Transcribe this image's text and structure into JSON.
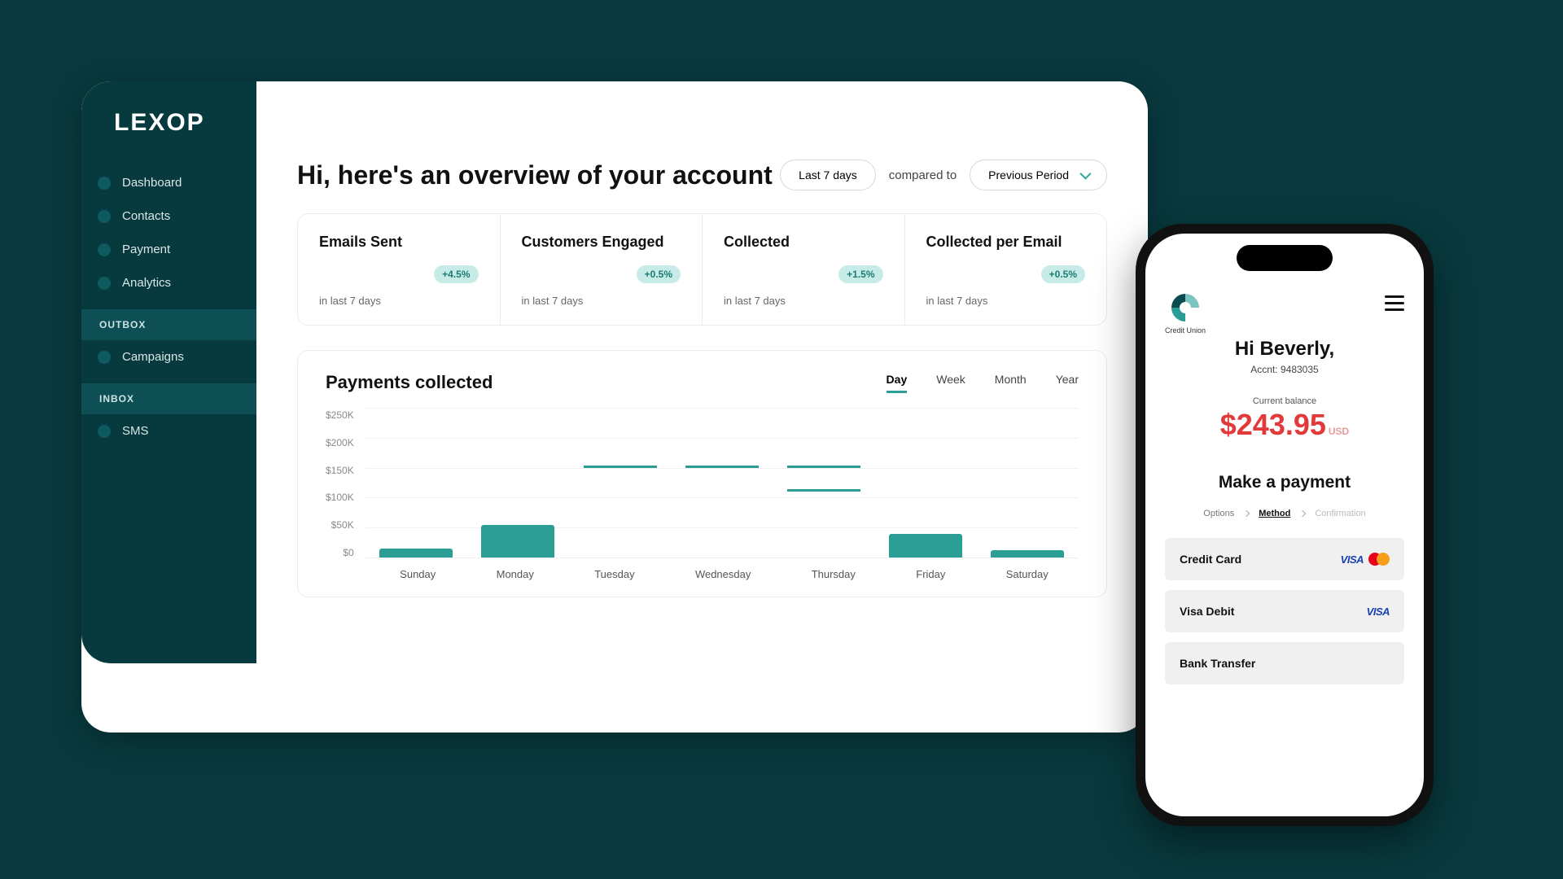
{
  "sidebar": {
    "logo": "LEXOP",
    "items": [
      "Dashboard",
      "Contacts",
      "Payment",
      "Analytics"
    ],
    "section_outbox": "OUTBOX",
    "outbox_items": [
      "Campaigns"
    ],
    "section_inbox": "INBOX",
    "inbox_items": [
      "SMS"
    ]
  },
  "header": {
    "title": "Hi, here's an overview of your account",
    "range_label": "Last 7 days",
    "compared_label": "compared to",
    "period_label": "Previous Period"
  },
  "stats": [
    {
      "title": "Emails Sent",
      "badge": "+4.5%",
      "sub": "in last 7 days"
    },
    {
      "title": "Customers Engaged",
      "badge": "+0.5%",
      "sub": "in last 7 days"
    },
    {
      "title": "Collected",
      "badge": "+1.5%",
      "sub": "in last 7 days"
    },
    {
      "title": "Collected per Email",
      "badge": "+0.5%",
      "sub": "in last 7 days"
    }
  ],
  "chart": {
    "title": "Payments collected",
    "tabs": [
      "Day",
      "Week",
      "Month",
      "Year"
    ],
    "active_tab": "Day",
    "y_ticks": [
      "$250K",
      "$200K",
      "$150K",
      "$100K",
      "$50K",
      "$0"
    ],
    "x_labels": [
      "Sunday",
      "Monday",
      "Tuesday",
      "Wednesday",
      "Thursday",
      "Friday",
      "Saturday"
    ]
  },
  "chart_data": {
    "type": "bar",
    "title": "Payments collected",
    "xlabel": "",
    "ylabel": "",
    "ylim": [
      0,
      250000
    ],
    "categories": [
      "Sunday",
      "Monday",
      "Tuesday",
      "Wednesday",
      "Thursday",
      "Friday",
      "Saturday"
    ],
    "series": [
      {
        "name": "collected_bars",
        "values": [
          15000,
          55000,
          0,
          0,
          0,
          40000,
          12000
        ]
      },
      {
        "name": "target_markers",
        "values": [
          null,
          null,
          150000,
          150000,
          150000,
          null,
          null
        ]
      },
      {
        "name": "secondary_markers",
        "values": [
          null,
          null,
          null,
          null,
          110000,
          null,
          null
        ]
      }
    ]
  },
  "phone": {
    "brand": "Credit Union",
    "greeting": "Hi Beverly,",
    "account_label": "Accnt: 9483035",
    "balance_label": "Current balance",
    "balance_amount": "$243.95",
    "balance_currency": "USD",
    "make_payment": "Make a payment",
    "steps": [
      "Options",
      "Method",
      "Confirmation"
    ],
    "active_step": "Method",
    "methods": [
      "Credit Card",
      "Visa Debit",
      "Bank Transfer"
    ]
  }
}
